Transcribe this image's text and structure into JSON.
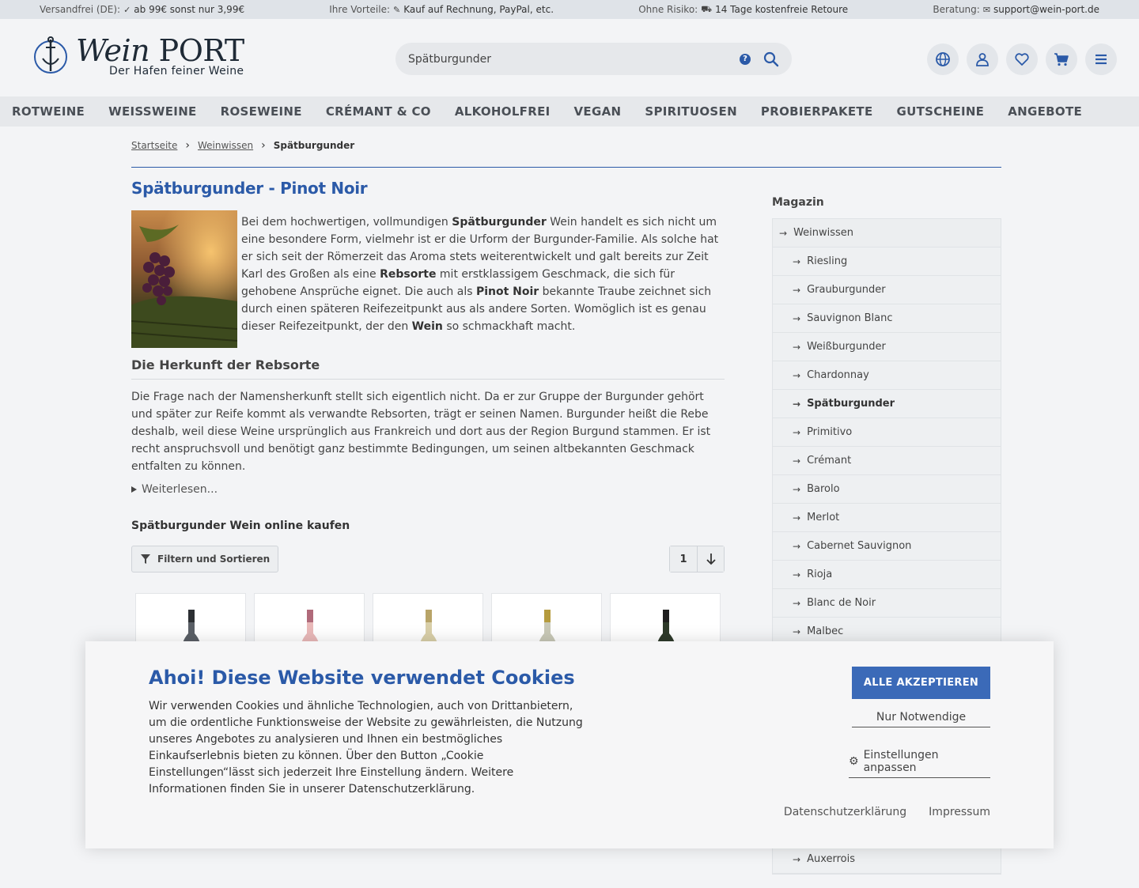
{
  "topbar": {
    "shipping_label": "Versandfrei (DE):",
    "shipping_text": "ab 99€ sonst nur 3,99€",
    "advantages_label": "Ihre Vorteile:",
    "advantages_text": "Kauf auf Rechnung, PayPal, etc.",
    "risk_label": "Ohne Risiko:",
    "risk_text": "14 Tage kostenfreie Retoure",
    "advice_label": "Beratung:",
    "advice_text": "support@wein-port.de"
  },
  "logo": {
    "brand": "Wein",
    "brand2": "PORT",
    "tagline": "Der Hafen feiner Weine"
  },
  "search": {
    "value": "Spätburgunder",
    "help": "?"
  },
  "nav": [
    "ROTWEINE",
    "WEISSWEINE",
    "ROSEWEINE",
    "CRÉMANT & CO",
    "ALKOHOLFREI",
    "VEGAN",
    "SPIRITUOSEN",
    "PROBIERPAKETE",
    "GUTSCHEINE",
    "ANGEBOTE"
  ],
  "breadcrumb": {
    "home": "Startseite",
    "parent": "Weinwissen",
    "current": "Spätburgunder"
  },
  "main": {
    "title": "Spätburgunder - Pinot Noir",
    "intro": [
      {
        "t": "Bei dem hochwertigen, vollmundigen ",
        "b": false
      },
      {
        "t": "Spätburgunder",
        "b": true
      },
      {
        "t": " Wein handelt es sich nicht um eine besondere Form, vielmehr ist er die Urform der Burgunder-Familie. Als solche hat er sich seit der Römerzeit das Aroma stets weiterentwickelt und galt bereits zur Zeit Karl des Großen als eine ",
        "b": false
      },
      {
        "t": "Rebsorte",
        "b": true
      },
      {
        "t": " mit erstklassigem Geschmack, die sich für gehobene Ansprüche eignet. Die auch als ",
        "b": false
      },
      {
        "t": "Pinot Noir",
        "b": true
      },
      {
        "t": " bekannte Traube zeichnet sich durch einen späteren Reifezeitpunkt aus als andere Sorten. Womöglich ist es genau dieser Reifezeitpunkt, der den ",
        "b": false
      },
      {
        "t": "Wein",
        "b": true
      },
      {
        "t": " so schmackhaft macht.",
        "b": false
      }
    ],
    "origin_heading": "Die Herkunft der Rebsorte",
    "origin_text": "Die Frage nach der Namensherkunft stellt sich eigentlich nicht. Da er zur Gruppe der Burgunder gehört und später zur Reife kommt als verwandte Rebsorten, trägt er seinen Namen. Burgunder heißt die Rebe deshalb, weil diese Weine ursprünglich aus Frankreich und dort aus der Region Burgund stammen. Er ist recht anspruchsvoll und benötigt ganz bestimmte Bedingungen, um seinen altbekannten Geschmack entfalten zu können.",
    "read_more": "Weiterlesen...",
    "shop_heading": "Spätburgunder Wein online kaufen",
    "filter_label": "Filtern und Sortieren",
    "page": "1"
  },
  "sidebar": {
    "title": "Magazin",
    "top": "Weinwissen",
    "items": [
      "Riesling",
      "Grauburgunder",
      "Sauvignon Blanc",
      "Weißburgunder",
      "Chardonnay",
      "Spätburgunder",
      "Primitivo",
      "Crémant",
      "Barolo",
      "Merlot",
      "Cabernet Sauvignon",
      "Rioja",
      "Blanc de Noir",
      "Malbec",
      "",
      "",
      "",
      "",
      "",
      "",
      "",
      "Auxerrois"
    ],
    "active": "Spätburgunder"
  },
  "cookie": {
    "title": "Ahoi! Diese Website verwendet Cookies",
    "text": "Wir verwenden Cookies und ähnliche Technologien, auch von Drittanbietern, um die ordentliche Funktionsweise der Website zu gewährleisten, die Nutzung unseres Angebotes zu analysieren und Ihnen ein bestmögliches Einkaufserlebnis bieten zu können. Über den Button „Cookie Einstellungen“lässt sich jederzeit Ihre Einstellung ändern. Weitere Informationen finden Sie in unserer Datenschutzerklärung.",
    "accept": "ALLE AKZEPTIEREN",
    "necessary": "Nur Notwendige",
    "adjust": "Einstellungen anpassen",
    "privacy": "Datenschutzerklärung",
    "imprint": "Impressum"
  },
  "colors": {
    "accent": "#2b5aa8",
    "button": "#3b6ab8"
  }
}
